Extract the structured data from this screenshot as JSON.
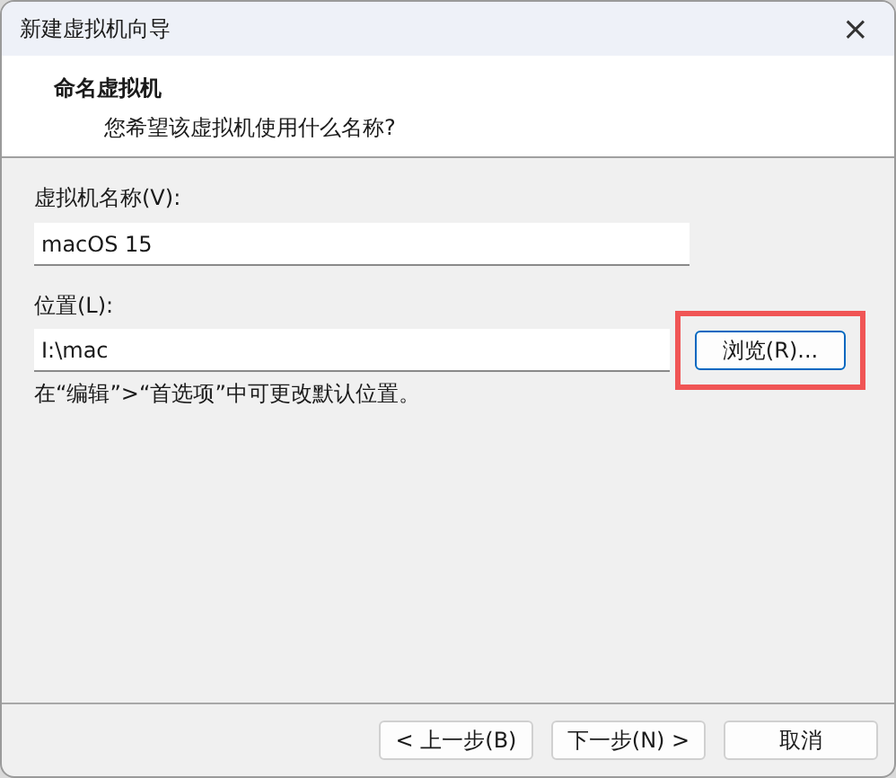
{
  "window": {
    "title": "新建虚拟机向导",
    "close": "×"
  },
  "header": {
    "title": "命名虚拟机",
    "subtitle": "您希望该虚拟机使用什么名称?"
  },
  "name_field": {
    "label": "虚拟机名称(V):",
    "value": "macOS 15"
  },
  "location_field": {
    "label": "位置(L):",
    "value": "I:\\mac",
    "browse": {
      "label": "浏览(R)...",
      "highlighted": true
    }
  },
  "hint": "在“编辑”>“首选项”中可更改默认位置。",
  "buttons": [
    {
      "label": "< 上一步(B)",
      "kind": "normal"
    },
    {
      "label": "下一步(N) >",
      "kind": "normal"
    },
    {
      "label": "取消",
      "kind": "normal"
    }
  ]
}
